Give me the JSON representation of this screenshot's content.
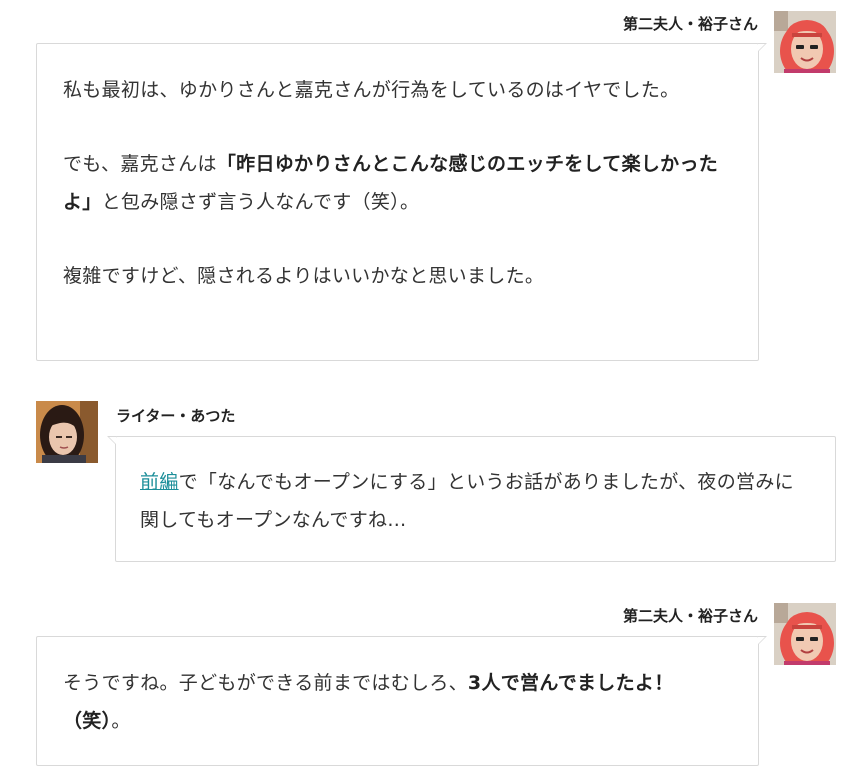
{
  "messages": [
    {
      "speaker": "第二夫人・裕子さん",
      "avatar": "yuko-avatar",
      "paragraphs": [
        [
          "私も最初は、ゆかりさんと嘉克さんが行為をしているのはイヤでした。"
        ],
        [
          "でも、嘉克さんは",
          "「昨日ゆかりさんとこんな感じのエッチをして楽しかったよ」",
          "と包み隠さず言う人なんです（笑）。"
        ],
        [
          "複雑ですけど、隠されるよりはいいかなと思いました。"
        ]
      ]
    },
    {
      "speaker": "ライター・あつた",
      "avatar": "atsuta-avatar",
      "link_text": "前編",
      "paragraphs": [
        [
          "で「なんでもオープンにする」というお話がありましたが、夜の営みに関してもオープンなんですね…"
        ]
      ]
    },
    {
      "speaker": "第二夫人・裕子さん",
      "avatar": "yuko-avatar",
      "paragraphs": [
        [
          "そうですね。子どもができる前まではむしろ、",
          "3人で営んでましたよ！（笑）",
          "。"
        ]
      ]
    }
  ],
  "colors": {
    "link": "#1b8e99",
    "border": "#d9d9d9",
    "text": "#333333"
  }
}
